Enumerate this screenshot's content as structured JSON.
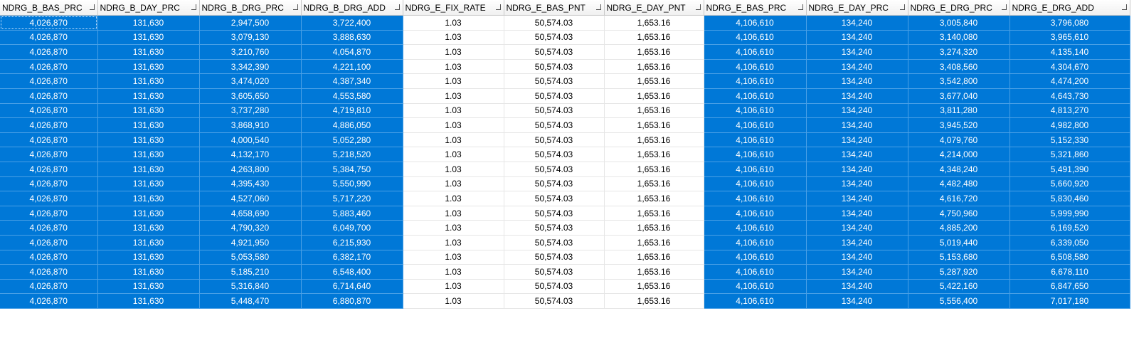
{
  "grid": {
    "columns": [
      "NDRG_B_BAS_PRC",
      "NDRG_B_DAY_PRC",
      "NDRG_B_DRG_PRC",
      "NDRG_B_DRG_ADD",
      "NDRG_E_FIX_RATE",
      "NDRG_E_BAS_PNT",
      "NDRG_E_DAY_PNT",
      "NDRG_E_BAS_PRC",
      "NDRG_E_DAY_PRC",
      "NDRG_E_DRG_PRC",
      "NDRG_E_DRG_ADD"
    ],
    "selected_columns": [
      0,
      1,
      2,
      3,
      7,
      8,
      9,
      10
    ],
    "selection_color": "#0078d7",
    "rows": [
      [
        "4,026,870",
        "131,630",
        "2,947,500",
        "3,722,400",
        "1.03",
        "50,574.03",
        "1,653.16",
        "4,106,610",
        "134,240",
        "3,005,840",
        "3,796,080"
      ],
      [
        "4,026,870",
        "131,630",
        "3,079,130",
        "3,888,630",
        "1.03",
        "50,574.03",
        "1,653.16",
        "4,106,610",
        "134,240",
        "3,140,080",
        "3,965,610"
      ],
      [
        "4,026,870",
        "131,630",
        "3,210,760",
        "4,054,870",
        "1.03",
        "50,574.03",
        "1,653.16",
        "4,106,610",
        "134,240",
        "3,274,320",
        "4,135,140"
      ],
      [
        "4,026,870",
        "131,630",
        "3,342,390",
        "4,221,100",
        "1.03",
        "50,574.03",
        "1,653.16",
        "4,106,610",
        "134,240",
        "3,408,560",
        "4,304,670"
      ],
      [
        "4,026,870",
        "131,630",
        "3,474,020",
        "4,387,340",
        "1.03",
        "50,574.03",
        "1,653.16",
        "4,106,610",
        "134,240",
        "3,542,800",
        "4,474,200"
      ],
      [
        "4,026,870",
        "131,630",
        "3,605,650",
        "4,553,580",
        "1.03",
        "50,574.03",
        "1,653.16",
        "4,106,610",
        "134,240",
        "3,677,040",
        "4,643,730"
      ],
      [
        "4,026,870",
        "131,630",
        "3,737,280",
        "4,719,810",
        "1.03",
        "50,574.03",
        "1,653.16",
        "4,106,610",
        "134,240",
        "3,811,280",
        "4,813,270"
      ],
      [
        "4,026,870",
        "131,630",
        "3,868,910",
        "4,886,050",
        "1.03",
        "50,574.03",
        "1,653.16",
        "4,106,610",
        "134,240",
        "3,945,520",
        "4,982,800"
      ],
      [
        "4,026,870",
        "131,630",
        "4,000,540",
        "5,052,280",
        "1.03",
        "50,574.03",
        "1,653.16",
        "4,106,610",
        "134,240",
        "4,079,760",
        "5,152,330"
      ],
      [
        "4,026,870",
        "131,630",
        "4,132,170",
        "5,218,520",
        "1.03",
        "50,574.03",
        "1,653.16",
        "4,106,610",
        "134,240",
        "4,214,000",
        "5,321,860"
      ],
      [
        "4,026,870",
        "131,630",
        "4,263,800",
        "5,384,750",
        "1.03",
        "50,574.03",
        "1,653.16",
        "4,106,610",
        "134,240",
        "4,348,240",
        "5,491,390"
      ],
      [
        "4,026,870",
        "131,630",
        "4,395,430",
        "5,550,990",
        "1.03",
        "50,574.03",
        "1,653.16",
        "4,106,610",
        "134,240",
        "4,482,480",
        "5,660,920"
      ],
      [
        "4,026,870",
        "131,630",
        "4,527,060",
        "5,717,220",
        "1.03",
        "50,574.03",
        "1,653.16",
        "4,106,610",
        "134,240",
        "4,616,720",
        "5,830,460"
      ],
      [
        "4,026,870",
        "131,630",
        "4,658,690",
        "5,883,460",
        "1.03",
        "50,574.03",
        "1,653.16",
        "4,106,610",
        "134,240",
        "4,750,960",
        "5,999,990"
      ],
      [
        "4,026,870",
        "131,630",
        "4,790,320",
        "6,049,700",
        "1.03",
        "50,574.03",
        "1,653.16",
        "4,106,610",
        "134,240",
        "4,885,200",
        "6,169,520"
      ],
      [
        "4,026,870",
        "131,630",
        "4,921,950",
        "6,215,930",
        "1.03",
        "50,574.03",
        "1,653.16",
        "4,106,610",
        "134,240",
        "5,019,440",
        "6,339,050"
      ],
      [
        "4,026,870",
        "131,630",
        "5,053,580",
        "6,382,170",
        "1.03",
        "50,574.03",
        "1,653.16",
        "4,106,610",
        "134,240",
        "5,153,680",
        "6,508,580"
      ],
      [
        "4,026,870",
        "131,630",
        "5,185,210",
        "6,548,400",
        "1.03",
        "50,574.03",
        "1,653.16",
        "4,106,610",
        "134,240",
        "5,287,920",
        "6,678,110"
      ],
      [
        "4,026,870",
        "131,630",
        "5,316,840",
        "6,714,640",
        "1.03",
        "50,574.03",
        "1,653.16",
        "4,106,610",
        "134,240",
        "5,422,160",
        "6,847,650"
      ],
      [
        "4,026,870",
        "131,630",
        "5,448,470",
        "6,880,870",
        "1.03",
        "50,574.03",
        "1,653.16",
        "4,106,610",
        "134,240",
        "5,556,400",
        "7,017,180"
      ]
    ]
  }
}
